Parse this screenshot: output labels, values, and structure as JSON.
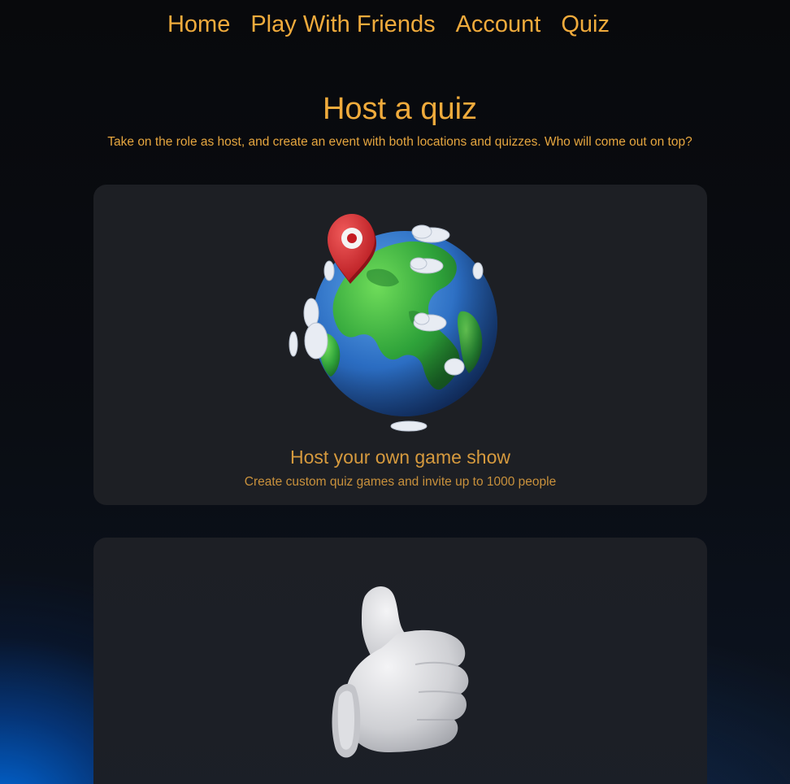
{
  "nav": {
    "items": [
      {
        "label": "Home"
      },
      {
        "label": "Play With Friends"
      },
      {
        "label": "Account"
      },
      {
        "label": "Quiz"
      }
    ]
  },
  "hero": {
    "title": "Host a quiz",
    "subtitle": "Take on the role as host, and create an event with both locations and quizzes. Who will come out on top?"
  },
  "cards": [
    {
      "title": "Host your own game show",
      "description": "Create custom quiz games and invite up to 1000 people",
      "illustration": "globe-with-location-pin"
    },
    {
      "illustration": "thumbs-up-hand"
    }
  ],
  "colors": {
    "accent": "#f0ab3c",
    "card_bg": "#1d1f24",
    "page_bg": "#0a0c10",
    "glow": "#0a6ee6"
  }
}
